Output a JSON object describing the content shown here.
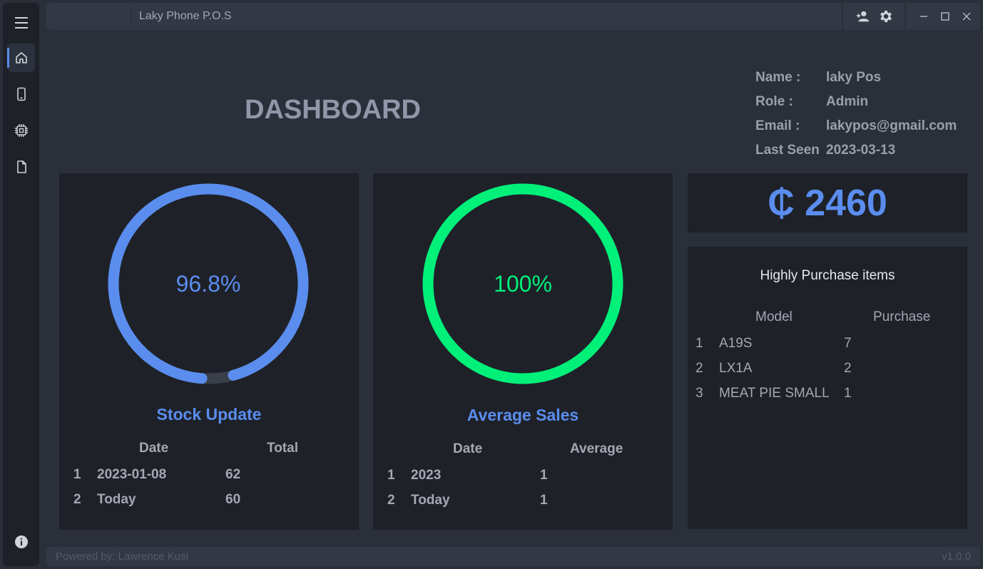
{
  "app": {
    "title": "Laky Phone P.O.S"
  },
  "nav": {
    "items": [
      {
        "name": "home",
        "icon": "home-icon",
        "active": true
      },
      {
        "name": "phones",
        "icon": "phone-icon",
        "active": false
      },
      {
        "name": "chip",
        "icon": "chip-icon",
        "active": false
      },
      {
        "name": "document",
        "icon": "document-icon",
        "active": false
      }
    ],
    "bottom_icon": "info-icon"
  },
  "titlebar": {
    "icons": [
      "add-user-icon",
      "gear-icon"
    ],
    "window_controls": [
      "minimize-icon",
      "maximize-icon",
      "close-icon"
    ]
  },
  "page": {
    "heading": "DASHBOARD"
  },
  "user": {
    "name_label": "Name :",
    "name": "laky Pos",
    "role_label": "Role :",
    "role": "Admin",
    "email_label": "Email :",
    "email": "lakypos@gmail.com",
    "last_seen_label": "Last Seen",
    "last_seen": "2023-03-13"
  },
  "stock": {
    "percent_text": "96.8%",
    "percent_value": 96.8,
    "color": "#5a8dee",
    "title": "Stock Update",
    "col_date": "Date",
    "col_total": "Total",
    "rows": [
      {
        "idx": "1",
        "date": "2023-01-08",
        "total": "62"
      },
      {
        "idx": "2",
        "date": "Today",
        "total": "60"
      }
    ]
  },
  "sales": {
    "percent_text": "100%",
    "percent_value": 100,
    "color": "#00f07a",
    "title": "Average Sales",
    "col_date": "Date",
    "col_average": "Average",
    "rows": [
      {
        "idx": "1",
        "date": "2023",
        "average": "1"
      },
      {
        "idx": "2",
        "date": "Today",
        "average": "1"
      }
    ]
  },
  "total": {
    "amount": "₵ 2460"
  },
  "purchases": {
    "title": "Highly Purchase items",
    "col_model": "Model",
    "col_purchase": "Purchase",
    "rows": [
      {
        "idx": "1",
        "model": "A19S",
        "purchase": "7"
      },
      {
        "idx": "2",
        "model": "LX1A",
        "purchase": "2"
      },
      {
        "idx": "3",
        "model": "MEAT PIE SMALL",
        "purchase": "1"
      }
    ]
  },
  "footer": {
    "credit": "Powered by: Lawrence Kusi",
    "version": "v1.0.0"
  },
  "colors": {
    "accent": "#5a8dee",
    "success": "#00f07a",
    "panel": "#1e2128",
    "background": "#2a2f39"
  }
}
